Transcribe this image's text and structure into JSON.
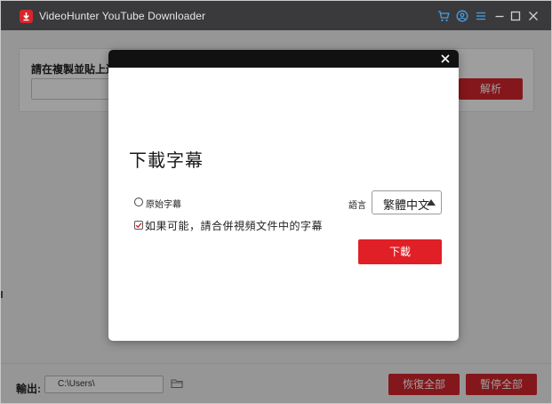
{
  "app": {
    "title": "VideoHunter YouTube Downloader",
    "accent_color": "#d6262c",
    "icons": [
      "cart-icon",
      "account-icon",
      "menu-icon",
      "minimize-icon",
      "maximize-icon",
      "close-icon"
    ]
  },
  "url_section": {
    "label": "請在複製並貼上連",
    "input_value": "",
    "parse_button": "解析"
  },
  "bottom_bar": {
    "output_label": "輸出:",
    "output_path": "C:\\Users\\",
    "resume_all": "恢復全部",
    "pause_all": "暫停全部"
  },
  "dialog": {
    "title": "下載字幕",
    "original_subtitle_label": "原始字幕",
    "original_subtitle_selected": false,
    "language_label": "語言",
    "language_value": "繁體中文",
    "merge_label": "如果可能，請合併視頻文件中的字幕",
    "merge_checked": true,
    "download_button": "下載"
  }
}
